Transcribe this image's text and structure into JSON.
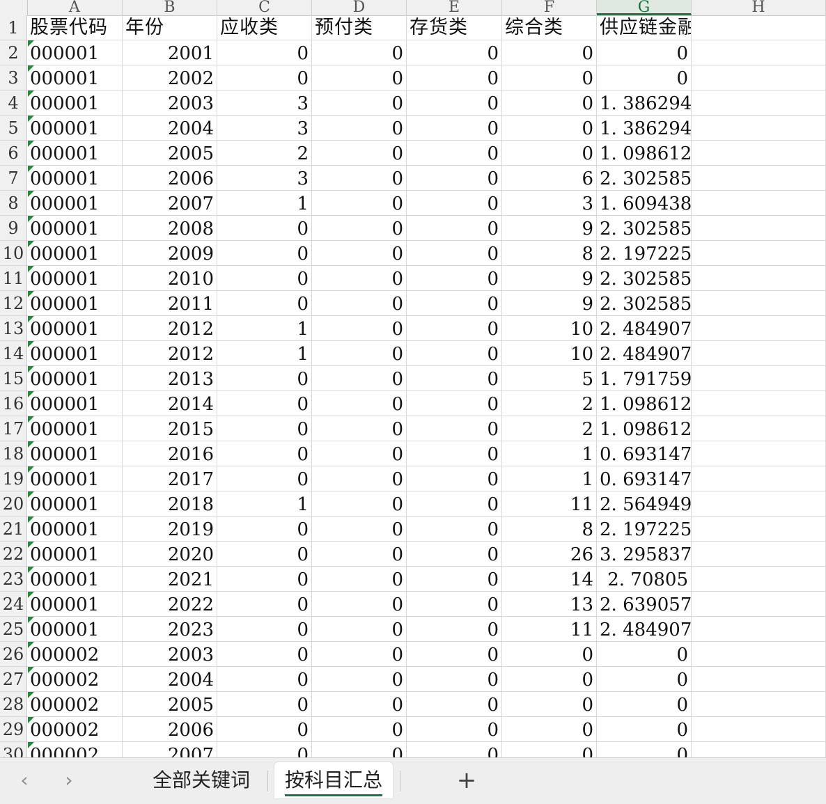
{
  "sheet": {
    "column_letters": [
      "A",
      "B",
      "C",
      "D",
      "E",
      "F",
      "G",
      "H"
    ],
    "selected_column": "G",
    "headers": [
      "股票代码",
      "年份",
      "应收类",
      "预付类",
      "存货类",
      "综合类",
      "供应链金融水平"
    ],
    "rows": [
      {
        "n": "2",
        "cells": [
          "000001",
          "2001",
          "0",
          "0",
          "0",
          "0",
          "0"
        ]
      },
      {
        "n": "3",
        "cells": [
          "000001",
          "2002",
          "0",
          "0",
          "0",
          "0",
          "0"
        ]
      },
      {
        "n": "4",
        "cells": [
          "000001",
          "2003",
          "3",
          "0",
          "0",
          "0",
          "1. 386294"
        ]
      },
      {
        "n": "5",
        "cells": [
          "000001",
          "2004",
          "3",
          "0",
          "0",
          "0",
          "1. 386294"
        ]
      },
      {
        "n": "6",
        "cells": [
          "000001",
          "2005",
          "2",
          "0",
          "0",
          "0",
          "1. 098612"
        ]
      },
      {
        "n": "7",
        "cells": [
          "000001",
          "2006",
          "3",
          "0",
          "0",
          "6",
          "2. 302585"
        ]
      },
      {
        "n": "8",
        "cells": [
          "000001",
          "2007",
          "1",
          "0",
          "0",
          "3",
          "1. 609438"
        ]
      },
      {
        "n": "9",
        "cells": [
          "000001",
          "2008",
          "0",
          "0",
          "0",
          "9",
          "2. 302585"
        ]
      },
      {
        "n": "10",
        "cells": [
          "000001",
          "2009",
          "0",
          "0",
          "0",
          "8",
          "2. 197225"
        ]
      },
      {
        "n": "11",
        "cells": [
          "000001",
          "2010",
          "0",
          "0",
          "0",
          "9",
          "2. 302585"
        ]
      },
      {
        "n": "12",
        "cells": [
          "000001",
          "2011",
          "0",
          "0",
          "0",
          "9",
          "2. 302585"
        ]
      },
      {
        "n": "13",
        "cells": [
          "000001",
          "2012",
          "1",
          "0",
          "0",
          "10",
          "2. 484907"
        ]
      },
      {
        "n": "14",
        "cells": [
          "000001",
          "2012",
          "1",
          "0",
          "0",
          "10",
          "2. 484907"
        ]
      },
      {
        "n": "15",
        "cells": [
          "000001",
          "2013",
          "0",
          "0",
          "0",
          "5",
          "1. 791759"
        ]
      },
      {
        "n": "16",
        "cells": [
          "000001",
          "2014",
          "0",
          "0",
          "0",
          "2",
          "1. 098612"
        ]
      },
      {
        "n": "17",
        "cells": [
          "000001",
          "2015",
          "0",
          "0",
          "0",
          "2",
          "1. 098612"
        ]
      },
      {
        "n": "18",
        "cells": [
          "000001",
          "2016",
          "0",
          "0",
          "0",
          "1",
          "0. 693147"
        ]
      },
      {
        "n": "19",
        "cells": [
          "000001",
          "2017",
          "0",
          "0",
          "0",
          "1",
          "0. 693147"
        ]
      },
      {
        "n": "20",
        "cells": [
          "000001",
          "2018",
          "1",
          "0",
          "0",
          "11",
          "2. 564949"
        ]
      },
      {
        "n": "21",
        "cells": [
          "000001",
          "2019",
          "0",
          "0",
          "0",
          "8",
          "2. 197225"
        ]
      },
      {
        "n": "22",
        "cells": [
          "000001",
          "2020",
          "0",
          "0",
          "0",
          "26",
          "3. 295837"
        ]
      },
      {
        "n": "23",
        "cells": [
          "000001",
          "2021",
          "0",
          "0",
          "0",
          "14",
          "2. 70805"
        ]
      },
      {
        "n": "24",
        "cells": [
          "000001",
          "2022",
          "0",
          "0",
          "0",
          "13",
          "2. 639057"
        ]
      },
      {
        "n": "25",
        "cells": [
          "000001",
          "2023",
          "0",
          "0",
          "0",
          "11",
          "2. 484907"
        ]
      },
      {
        "n": "26",
        "cells": [
          "000002",
          "2003",
          "0",
          "0",
          "0",
          "0",
          "0"
        ]
      },
      {
        "n": "27",
        "cells": [
          "000002",
          "2004",
          "0",
          "0",
          "0",
          "0",
          "0"
        ]
      },
      {
        "n": "28",
        "cells": [
          "000002",
          "2005",
          "0",
          "0",
          "0",
          "0",
          "0"
        ]
      },
      {
        "n": "29",
        "cells": [
          "000002",
          "2006",
          "0",
          "0",
          "0",
          "0",
          "0"
        ]
      },
      {
        "n": "30",
        "cells": [
          "000002",
          "2007",
          "0",
          "0",
          "0",
          "0",
          "0"
        ]
      }
    ]
  },
  "tabs": {
    "prev_icon": "chevron-left-icon",
    "next_icon": "chevron-right-icon",
    "items": [
      "全部关键词",
      "按科目汇总"
    ],
    "active": "按科目汇总",
    "add_icon": "plus-icon",
    "accent_color": "#1e7145"
  }
}
